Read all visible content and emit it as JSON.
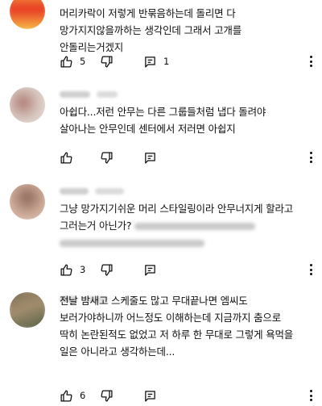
{
  "comments": [
    {
      "text": "머리카락이 저렇게 반묶음하는데 돌리면 다 망가지지않을까하는 생각인데 그래서 고개를 안돌리는거겠지",
      "likes": "5",
      "replies": "1",
      "avatar_colors": [
        "#f2a340",
        "#e83a24",
        "#f7c94a"
      ]
    },
    {
      "text": "아쉽다...저런 안무는 다른 그룹들처럼 냅다 돌려야 살아나는 안무인데 센터에서 저러면 아쉽지",
      "likes": "",
      "replies": "",
      "avatar_colors": [
        "#d7c8c0",
        "#b07f78",
        "#e8dcd4"
      ]
    },
    {
      "text_a": "그냥 망가지기쉬운 머리 스타일링이라 안무너지게 할라고 그러는거 아닌가?",
      "likes": "3",
      "replies": "",
      "avatar_colors": [
        "#caa694",
        "#8e6b5c",
        "#e5cfc2"
      ]
    },
    {
      "text": "전날 밤새고 스케줄도 많고 무대끝나면 엠씨도 보러가야하니까 어느정도 이해하는데 지금까지 춤으로 딱히 논란된적도 없었고 저 하루 한 무대로 그렇게 욕먹을 일은 아니라고 생각하는데...",
      "likes": "6",
      "replies": "",
      "avatar_colors": [
        "#7a6a52",
        "#a38e6e",
        "#4e5a42"
      ]
    }
  ],
  "icons": {
    "like": "thumbs-up-icon",
    "dislike": "thumbs-down-icon",
    "reply": "comment-icon",
    "menu": "more-vert-icon"
  }
}
